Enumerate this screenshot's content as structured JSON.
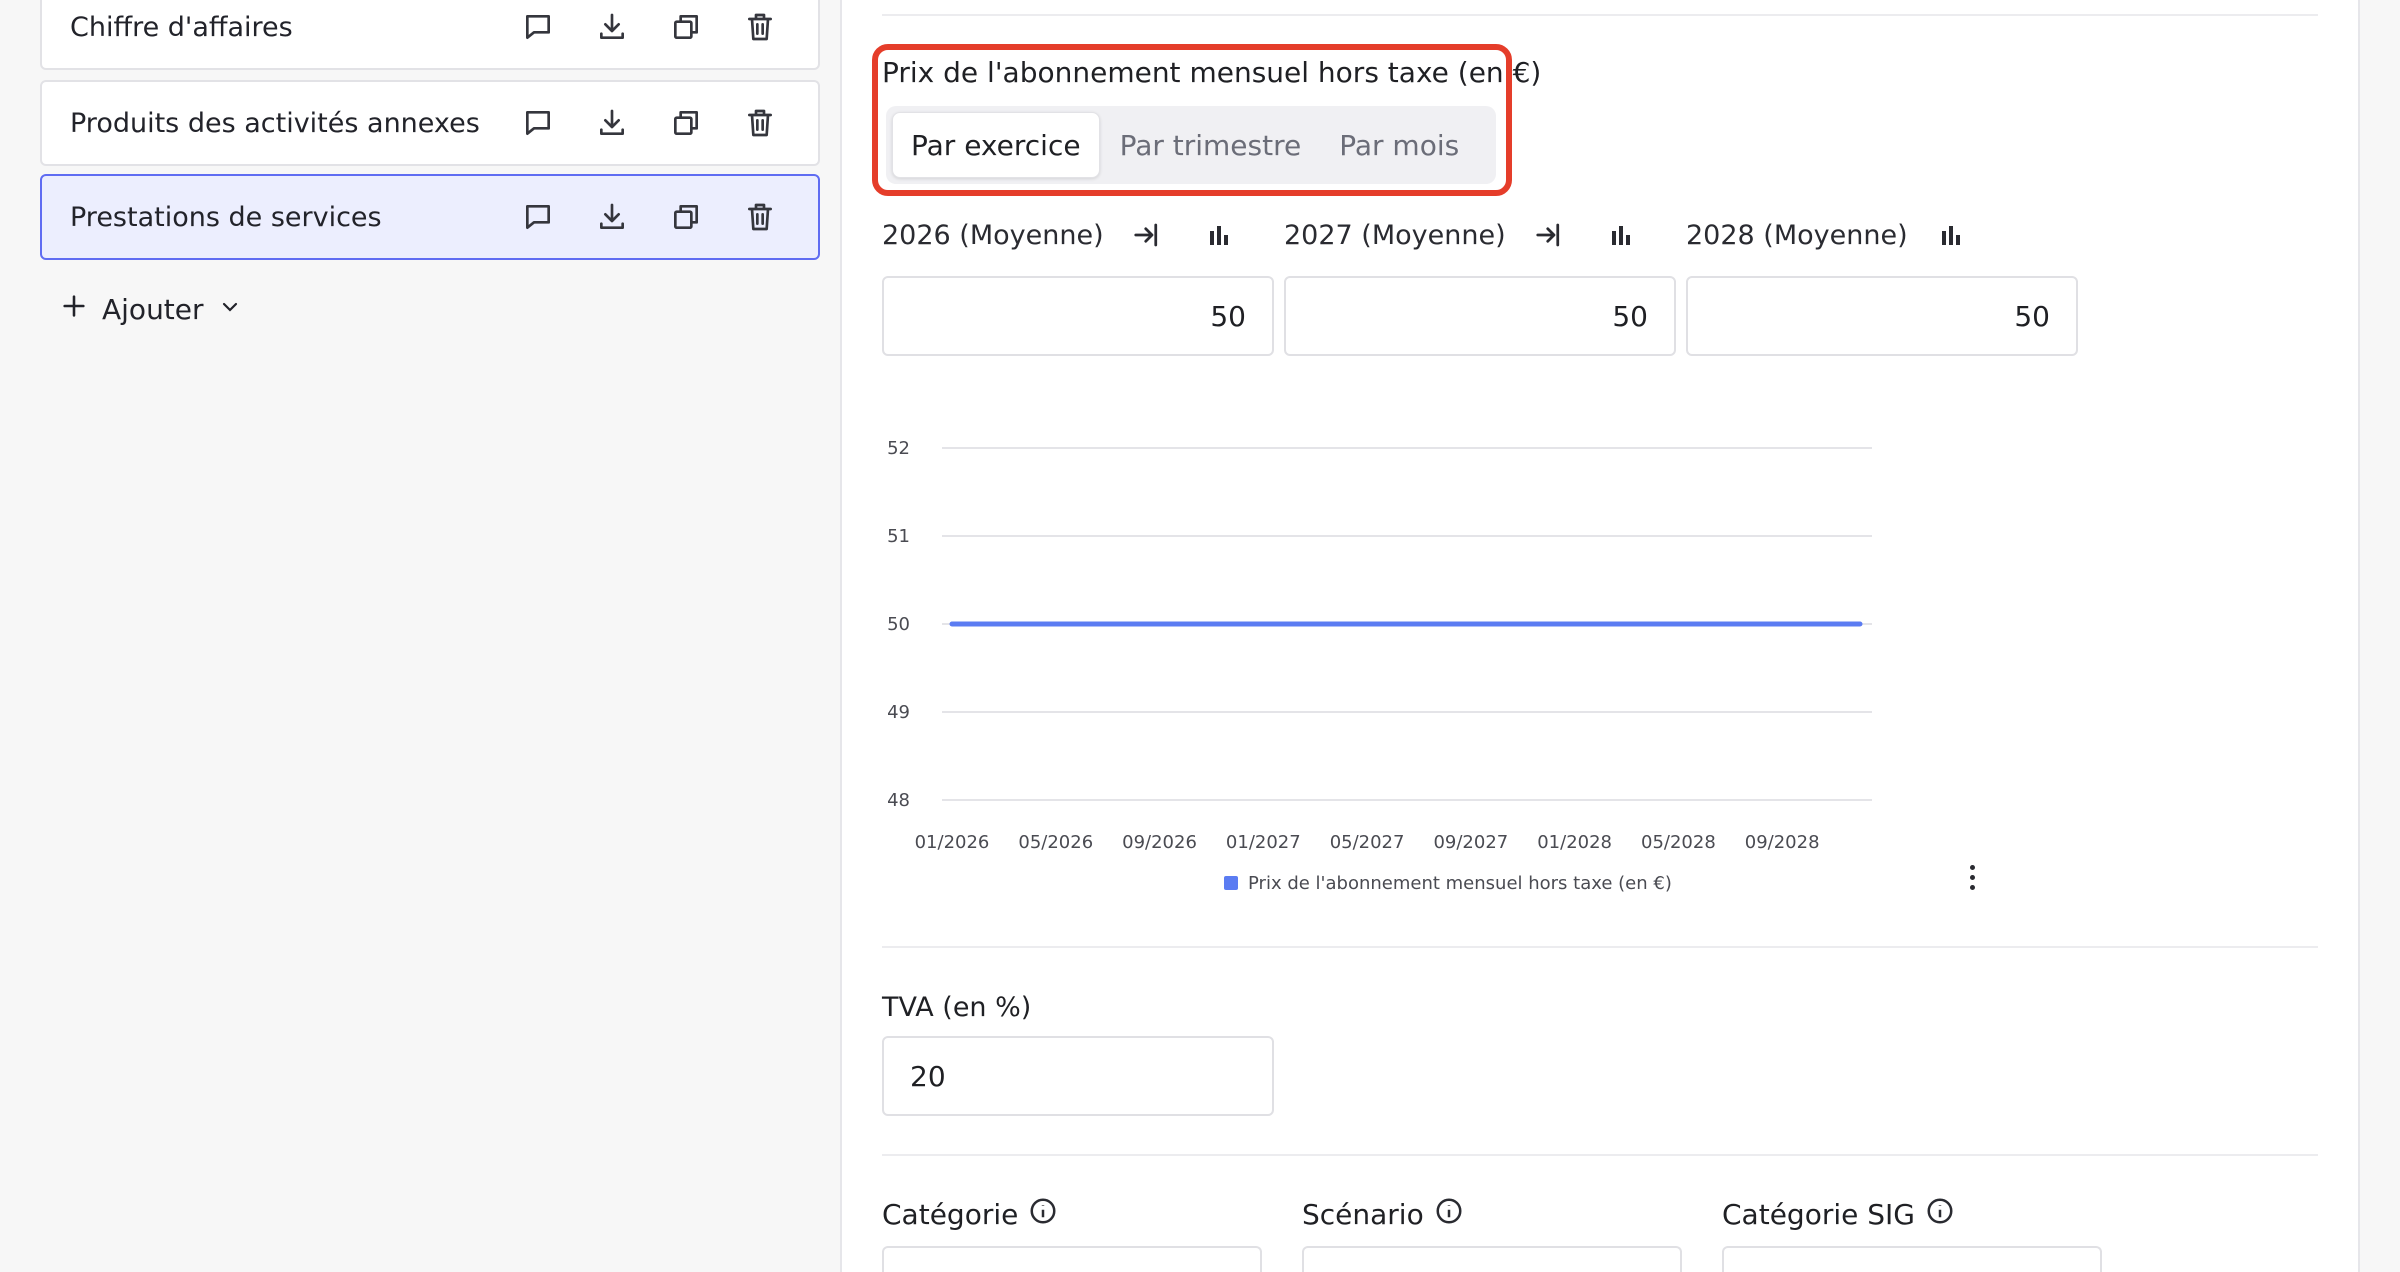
{
  "sidebar": {
    "items": [
      {
        "label": "Chiffre d'affaires",
        "selected": false
      },
      {
        "label": "Produits des activités annexes",
        "selected": false
      },
      {
        "label": "Prestations de services",
        "selected": true
      }
    ],
    "action_icons": [
      "comment-icon",
      "download-icon",
      "duplicate-icon",
      "trash-icon"
    ],
    "add_label": "Ajouter"
  },
  "price_section": {
    "title": "Prix de l'abonnement mensuel hors taxe (en €)",
    "periods": [
      "Par exercice",
      "Par trimestre",
      "Par mois"
    ],
    "active_period": "Par exercice",
    "years": [
      {
        "label": "2026 (Moyenne)",
        "value": "50"
      },
      {
        "label": "2027 (Moyenne)",
        "value": "50"
      },
      {
        "label": "2028 (Moyenne)",
        "value": "50"
      }
    ]
  },
  "chart_data": {
    "type": "line",
    "x": [
      "01/2026",
      "02/2026",
      "03/2026",
      "04/2026",
      "05/2026",
      "06/2026",
      "07/2026",
      "08/2026",
      "09/2026",
      "10/2026",
      "11/2026",
      "12/2026",
      "01/2027",
      "02/2027",
      "03/2027",
      "04/2027",
      "05/2027",
      "06/2027",
      "07/2027",
      "08/2027",
      "09/2027",
      "10/2027",
      "11/2027",
      "12/2027",
      "01/2028",
      "02/2028",
      "03/2028",
      "04/2028",
      "05/2028",
      "06/2028",
      "07/2028",
      "08/2028",
      "09/2028",
      "10/2028",
      "11/2028",
      "12/2028"
    ],
    "x_ticks": [
      "01/2026",
      "05/2026",
      "09/2026",
      "01/2027",
      "05/2027",
      "09/2027",
      "01/2028",
      "05/2028",
      "09/2028"
    ],
    "y_ticks": [
      "52",
      "51",
      "50",
      "49",
      "48"
    ],
    "ylim": [
      48,
      52
    ],
    "series": [
      {
        "name": "Prix de l'abonnement mensuel hors taxe (en €)",
        "color": "#5b7cf2",
        "values": [
          50,
          50,
          50,
          50,
          50,
          50,
          50,
          50,
          50,
          50,
          50,
          50,
          50,
          50,
          50,
          50,
          50,
          50,
          50,
          50,
          50,
          50,
          50,
          50,
          50,
          50,
          50,
          50,
          50,
          50,
          50,
          50,
          50,
          50,
          50,
          50
        ]
      }
    ],
    "grid": true,
    "legend": "bottom"
  },
  "tva": {
    "label": "TVA (en %)",
    "value": "20"
  },
  "bottom_fields": [
    {
      "label": "Catégorie"
    },
    {
      "label": "Scénario"
    },
    {
      "label": "Catégorie SIG"
    }
  ],
  "colors": {
    "accent": "#5f6cf2",
    "highlight": "#e53d2a",
    "line": "#5b7cf2"
  }
}
